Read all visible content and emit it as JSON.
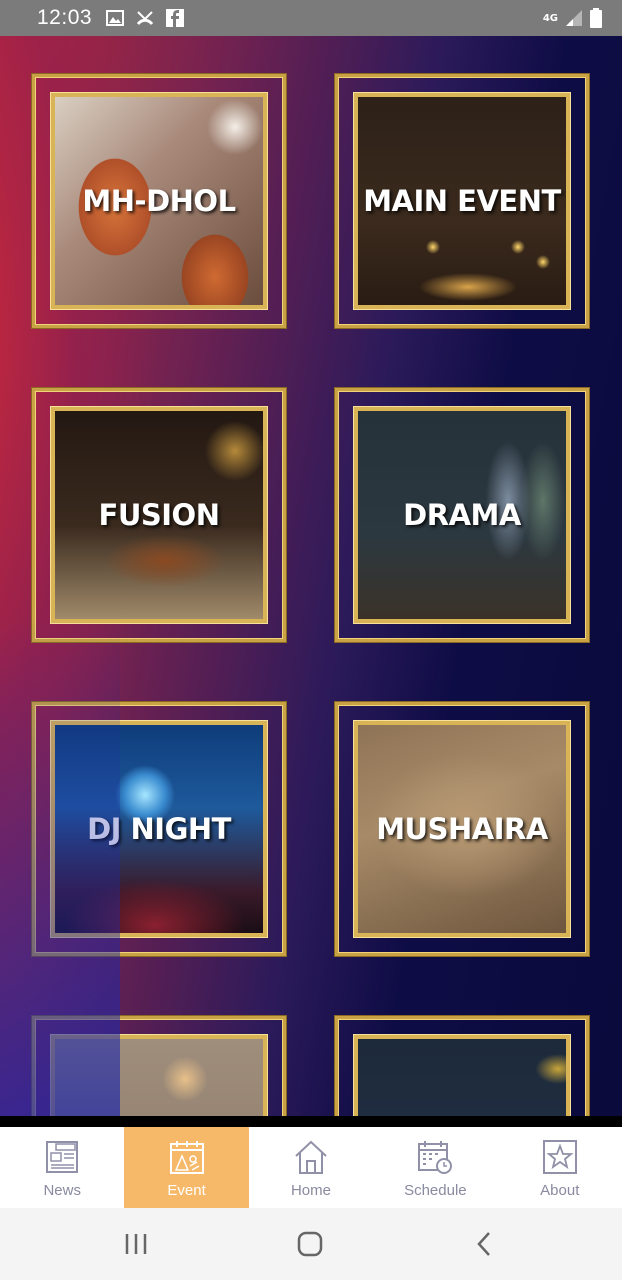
{
  "status_bar": {
    "time": "12:03",
    "network": "4G",
    "icons": [
      "gallery-icon",
      "missed-call-icon",
      "facebook-icon",
      "signal-icon",
      "battery-icon"
    ]
  },
  "tiles": [
    {
      "label": "MH-DHOL",
      "image": "dhol-drummers"
    },
    {
      "label": "MAIN EVENT",
      "image": "oil-lamp"
    },
    {
      "label": "FUSION",
      "image": "violin-instruments"
    },
    {
      "label": "DRAMA",
      "image": "stage-actors"
    },
    {
      "label": "DJ NIGHT",
      "image": "concert-crowd"
    },
    {
      "label": "MUSHAIRA",
      "image": "quill-pen"
    },
    {
      "label": "",
      "image": "party-mask"
    },
    {
      "label": "",
      "image": "dark-scene"
    }
  ],
  "bottom_nav": {
    "items": [
      {
        "label": "News",
        "icon": "newspaper-icon",
        "active": false
      },
      {
        "label": "Event",
        "icon": "event-icon",
        "active": true
      },
      {
        "label": "Home",
        "icon": "home-icon",
        "active": false
      },
      {
        "label": "Schedule",
        "icon": "calendar-clock-icon",
        "active": false
      },
      {
        "label": "About",
        "icon": "star-icon",
        "active": false
      }
    ]
  },
  "colors": {
    "gold": "#c9a245",
    "nav_active": "#f6b96a",
    "nav_text": "#8a8aa0"
  }
}
